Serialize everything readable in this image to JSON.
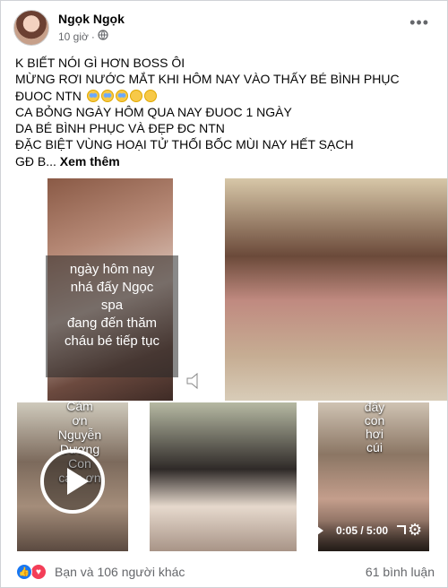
{
  "post": {
    "author": "Ngọk Ngọk",
    "time": "10 giờ",
    "separator": "·",
    "privacy_icon": "public-globe-icon",
    "more_icon": "more-options-icon",
    "text_lines": [
      "K BIẾT NÓI GÌ HƠN BOSS ÔI",
      "MỪNG RƠI NƯỚC MẮT KHI HÔM NAY VÀO THẤY BÉ BÌNH PHỤC",
      "ĐUOC NTN",
      "CA BỎNG NGÀY HÔM QUA NAY ĐUOC 1 NGÀY",
      "DA BÉ BÌNH PHỤC VÀ ĐẸP ĐC NTN",
      "ĐẶC BIỆT VÙNG HOẠI TỬ THỐI BỐC MÙI NAY HẾT SẠCH",
      "GĐ B..."
    ],
    "see_more": "Xem thêm"
  },
  "media": {
    "caption1": [
      "ngày hôm nay",
      "nhá đấy Ngọc",
      "spa",
      "đang đến thăm",
      "cháu bé tiếp tục"
    ],
    "caption3": [
      "Cảm",
      "ơn",
      "Nguyễn",
      "Dương",
      "Con",
      "cảm ơn"
    ],
    "caption5": [
      "đấy",
      "con",
      "hơi",
      "cúi"
    ],
    "video_time": "0:05 / 5:00"
  },
  "footer": {
    "reactions": "Bạn và 106 người khác",
    "comments": "61 bình luận",
    "like_color": "#1877f2",
    "love_color": "#f33e58"
  }
}
